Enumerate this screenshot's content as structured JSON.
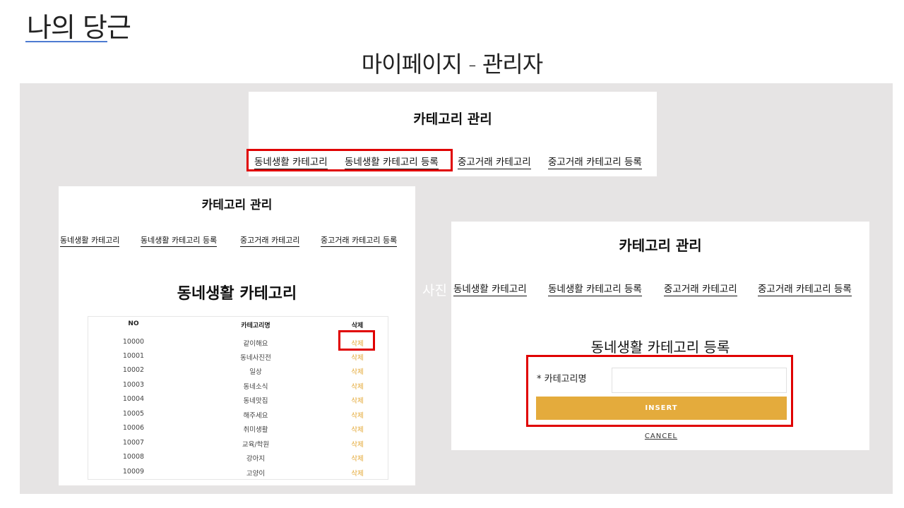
{
  "slide": {
    "title": "나의 당근",
    "subtitle": "마이페이지 - 관리자"
  },
  "top_panel": {
    "title": "카테고리 관리",
    "tabs": [
      "동네생활 카테고리",
      "동네생활 카테고리 등록",
      "중고거래 카테고리",
      "중고거래 카테고리 등록"
    ]
  },
  "left_panel": {
    "title": "카테고리 관리",
    "tabs": [
      "동네생활 카테고리",
      "동네생활 카테고리 등록",
      "중고거래 카테고리",
      "중고거래 카테고리 등록"
    ],
    "heading": "동네생활 카테고리",
    "table": {
      "headers": [
        "NO",
        "카테고리명",
        "삭제"
      ],
      "rows": [
        {
          "no": "10000",
          "name": "같이해요",
          "del": "삭제"
        },
        {
          "no": "10001",
          "name": "동네사진전",
          "del": "삭제"
        },
        {
          "no": "10002",
          "name": "일상",
          "del": "삭제"
        },
        {
          "no": "10003",
          "name": "동네소식",
          "del": "삭제"
        },
        {
          "no": "10004",
          "name": "동네맛집",
          "del": "삭제"
        },
        {
          "no": "10005",
          "name": "해주세요",
          "del": "삭제"
        },
        {
          "no": "10006",
          "name": "취미생활",
          "del": "삭제"
        },
        {
          "no": "10007",
          "name": "교육/학원",
          "del": "삭제"
        },
        {
          "no": "10008",
          "name": "강아지",
          "del": "삭제"
        },
        {
          "no": "10009",
          "name": "고양이",
          "del": "삭제"
        }
      ]
    }
  },
  "right_panel": {
    "title": "카테고리 관리",
    "ghost_text": "사진",
    "tabs": [
      "동네생활 카테고리",
      "동네생활 카테고리 등록",
      "중고거래 카테고리",
      "중고거래 카테고리 등록"
    ],
    "heading": "동네생활 카테고리 등록",
    "form_label": "* 카테고리명",
    "input_value": "",
    "insert_label": "INSERT",
    "cancel_label": "CANCEL"
  },
  "colors": {
    "highlight": "#e00000",
    "accent": "#e4ab3c",
    "background_gray": "#e6e4e4",
    "title_underline": "#4d7bd1"
  }
}
